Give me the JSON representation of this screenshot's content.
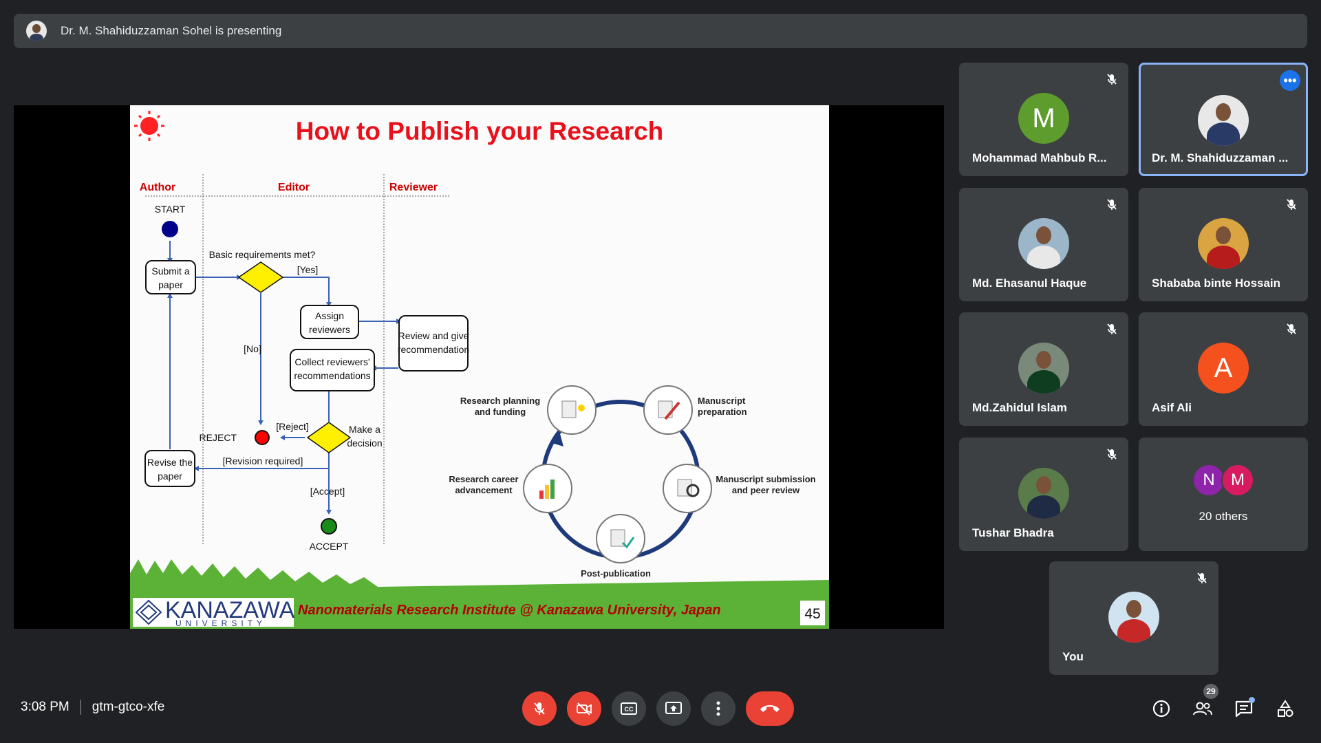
{
  "banner": {
    "text": "Dr. M. Shahiduzzaman Sohel is presenting"
  },
  "slide": {
    "title": "How to Publish your Research",
    "lanes": {
      "author": "Author",
      "editor": "Editor",
      "reviewer": "Reviewer"
    },
    "flow": {
      "start": "START",
      "submit_1": "Submit a",
      "submit_2": "paper",
      "basic_req": "Basic requirements met?",
      "yes": "[Yes]",
      "no": "[No]",
      "assign_1": "Assign",
      "assign_2": "reviewers",
      "review_1": "Review and give",
      "review_2": "recommendation",
      "collect_1": "Collect reviewers'",
      "collect_2": "recommendations",
      "reject_edge": "[Reject]",
      "reject": "REJECT",
      "decision_1": "Make a",
      "decision_2": "decision",
      "revise_1": "Revise the",
      "revise_2": "paper",
      "revision": "[Revision required]",
      "accept_edge": "[Accept]",
      "accept": "ACCEPT"
    },
    "cycle": {
      "planning_1": "Research planning",
      "planning_2": "and funding",
      "manuscript_1": "Manuscript",
      "manuscript_2": "preparation",
      "submission_1": "Manuscript submission",
      "submission_2": "and peer review",
      "career_1": "Research career",
      "career_2": "advancement",
      "post": "Post-publication"
    },
    "footer": {
      "logo_top": "KANAZAWA",
      "logo_bottom": "UNIVERSITY",
      "institute": "Nanomaterials Research Institute @ Kanazawa University, Japan",
      "page_number": "45"
    }
  },
  "participants": [
    {
      "name": "Mohammad Mahbub R...",
      "initial": "M",
      "color": "#5e9c2e"
    },
    {
      "name": "Dr. M. Shahiduzzaman ...",
      "more": "•••"
    },
    {
      "name": "Md. Ehasanul Haque"
    },
    {
      "name": "Shababa binte Hossain"
    },
    {
      "name": "Md.Zahidul Islam"
    },
    {
      "name": "Asif Ali",
      "initial": "A",
      "color": "#f4511e"
    },
    {
      "name": "Tushar Bhadra"
    },
    {
      "label": "20 others",
      "initial_1": "N",
      "initial_2": "M",
      "color_1": "#8e24aa",
      "color_2": "#d81b60"
    },
    {
      "name": "You"
    }
  ],
  "meeting": {
    "time": "3:08 PM",
    "code": "gtm-gtco-xfe"
  },
  "people_count": "29",
  "icons": [
    "mic-off-icon",
    "camera-off-icon",
    "captions-icon",
    "present-icon",
    "more-vert-icon",
    "hangup-icon",
    "info-icon",
    "people-icon",
    "chat-icon",
    "activities-icon"
  ]
}
